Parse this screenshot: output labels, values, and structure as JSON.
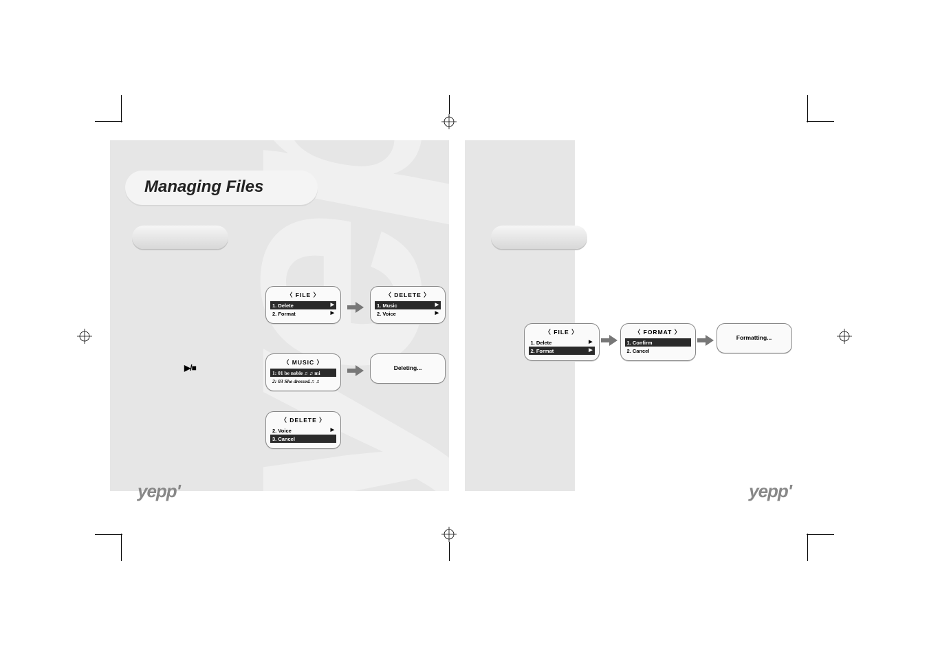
{
  "page_title": "Managing Files",
  "brand": "yepp'",
  "icons": {
    "playpause": "▶/■"
  },
  "left_page": {
    "file_menu": {
      "header": "FILE",
      "items": [
        {
          "label": "1.  Delete",
          "highlight": true,
          "arrow": true
        },
        {
          "label": "2.  Format",
          "highlight": false,
          "arrow": true
        }
      ]
    },
    "delete_menu": {
      "header": "DELETE",
      "items": [
        {
          "label": "1.  Music",
          "highlight": true,
          "arrow": true
        },
        {
          "label": "2.  Voice",
          "highlight": false,
          "arrow": true
        }
      ]
    },
    "music_menu": {
      "header": "MUSIC",
      "items": [
        {
          "label": "1: 01  be noble ♫ ♫ mi",
          "highlight": true,
          "arrow": false
        },
        {
          "label": "2: 03 She dressed.♫ ♫",
          "highlight": false,
          "arrow": false
        }
      ]
    },
    "deleting_msg": "Deleting...",
    "delete_menu2": {
      "header": "DELETE",
      "items": [
        {
          "label": "2.  Voice",
          "highlight": false,
          "arrow": true
        },
        {
          "label": "3.  Cancel",
          "highlight": true,
          "arrow": false
        }
      ]
    }
  },
  "right_page": {
    "file_menu": {
      "header": "FILE",
      "items": [
        {
          "label": "1.  Delete",
          "highlight": false,
          "arrow": true
        },
        {
          "label": "2.  Format",
          "highlight": true,
          "arrow": true
        }
      ]
    },
    "format_menu": {
      "header": "FORMAT",
      "items": [
        {
          "label": "1.  Confirm",
          "highlight": true,
          "arrow": false
        },
        {
          "label": "2.  Cancel",
          "highlight": false,
          "arrow": false
        }
      ]
    },
    "formatting_msg": "Formatting..."
  }
}
